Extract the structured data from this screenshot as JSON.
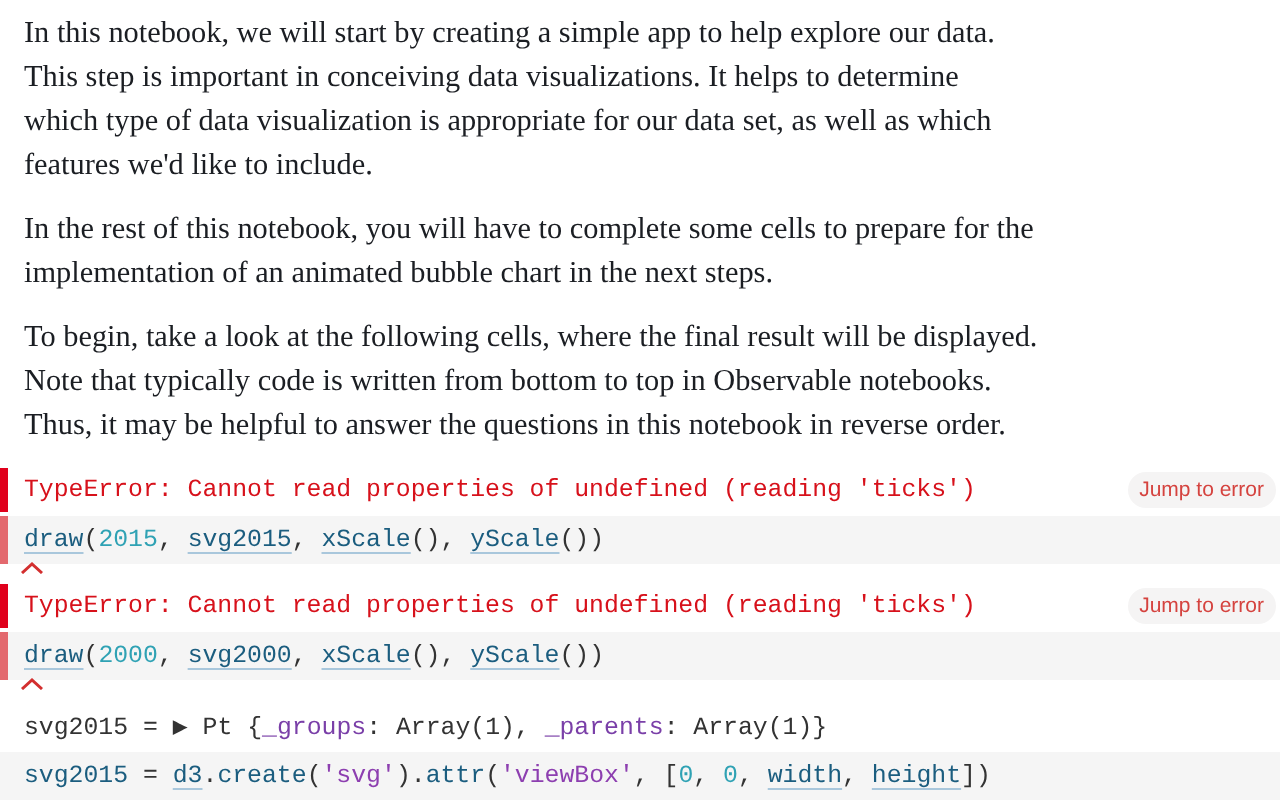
{
  "paragraphs": [
    "In this notebook, we will start by creating a simple app to help explore our data. This step is important in conceiving data visualizations. It helps to determine which type of data visualization is appropriate for our data set, as well as which features we'd like to include.",
    "In the rest of this notebook, you will have to complete some cells to prepare for the implementation of an animated bubble chart in the next steps.",
    "To begin, take a look at the following cells, where the final result will be displayed. Note that typically code is written from bottom to top in Observable notebooks. Thus, it may be helpful to answer the questions in this notebook in reverse order."
  ],
  "cells": [
    {
      "kind": "error",
      "message": "TypeError: Cannot read properties of undefined (reading 'ticks')",
      "jump_label": "Jump to error",
      "code": [
        {
          "t": "draw",
          "kind": "ref"
        },
        {
          "t": "(",
          "kind": "plain"
        },
        {
          "t": "2015",
          "kind": "num"
        },
        {
          "t": ", ",
          "kind": "plain"
        },
        {
          "t": "svg2015",
          "kind": "ref"
        },
        {
          "t": ", ",
          "kind": "plain"
        },
        {
          "t": "xScale",
          "kind": "ref"
        },
        {
          "t": "(), ",
          "kind": "plain"
        },
        {
          "t": "yScale",
          "kind": "ref"
        },
        {
          "t": "())",
          "kind": "plain"
        }
      ]
    },
    {
      "kind": "error",
      "message": "TypeError: Cannot read properties of undefined (reading 'ticks')",
      "jump_label": "Jump to error",
      "code": [
        {
          "t": "draw",
          "kind": "ref"
        },
        {
          "t": "(",
          "kind": "plain"
        },
        {
          "t": "2000",
          "kind": "num"
        },
        {
          "t": ", ",
          "kind": "plain"
        },
        {
          "t": "svg2000",
          "kind": "ref"
        },
        {
          "t": ", ",
          "kind": "plain"
        },
        {
          "t": "xScale",
          "kind": "ref"
        },
        {
          "t": "(), ",
          "kind": "plain"
        },
        {
          "t": "yScale",
          "kind": "ref"
        },
        {
          "t": "())",
          "kind": "plain"
        }
      ]
    },
    {
      "kind": "output",
      "code": [
        {
          "t": "svg2015 = ",
          "kind": "plain"
        },
        {
          "t": "▶",
          "kind": "plain"
        },
        {
          "t": " Pt {",
          "kind": "plain"
        },
        {
          "t": "_groups",
          "kind": "prop"
        },
        {
          "t": ": Array(1), ",
          "kind": "plain"
        },
        {
          "t": "_parents",
          "kind": "prop"
        },
        {
          "t": ": Array(1)}",
          "kind": "plain"
        }
      ]
    },
    {
      "kind": "code",
      "code": [
        {
          "t": "svg2015",
          "kind": "def"
        },
        {
          "t": " = ",
          "kind": "plain"
        },
        {
          "t": "d3",
          "kind": "ref"
        },
        {
          "t": ".",
          "kind": "plain"
        },
        {
          "t": "create",
          "kind": "def"
        },
        {
          "t": "(",
          "kind": "plain"
        },
        {
          "t": "'svg'",
          "kind": "str"
        },
        {
          "t": ").",
          "kind": "plain"
        },
        {
          "t": "attr",
          "kind": "def"
        },
        {
          "t": "(",
          "kind": "plain"
        },
        {
          "t": "'viewBox'",
          "kind": "str"
        },
        {
          "t": ", [",
          "kind": "plain"
        },
        {
          "t": "0",
          "kind": "num"
        },
        {
          "t": ", ",
          "kind": "plain"
        },
        {
          "t": "0",
          "kind": "num"
        },
        {
          "t": ", ",
          "kind": "plain"
        },
        {
          "t": "width",
          "kind": "ref"
        },
        {
          "t": ", ",
          "kind": "plain"
        },
        {
          "t": "height",
          "kind": "ref"
        },
        {
          "t": "])",
          "kind": "plain"
        }
      ]
    }
  ]
}
